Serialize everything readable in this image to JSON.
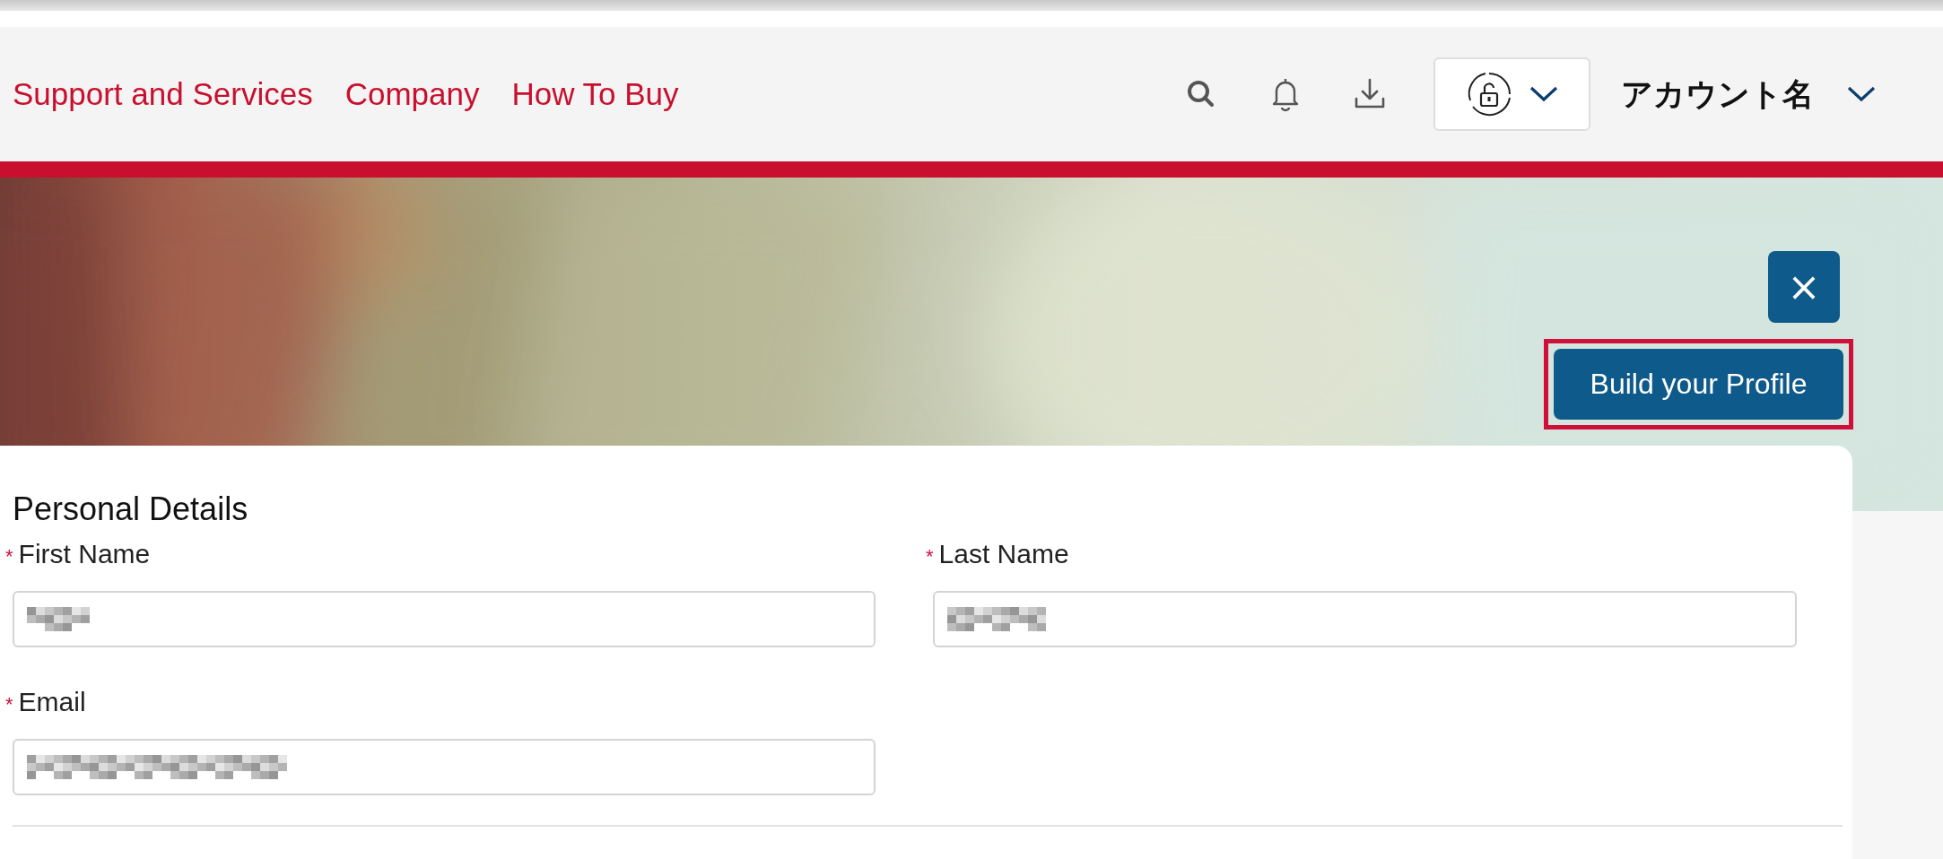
{
  "nav_links": [
    "Support and Services",
    "Company",
    "How To Buy"
  ],
  "account": {
    "name": "アカウント名"
  },
  "banner": {
    "kind": "picture",
    "close_button": "×",
    "profile_button": {
      "label": "Build your Profile",
      "highlighted": true
    }
  },
  "personal_details": {
    "title": "Personal Details",
    "fields": [
      {
        "label": "First Name",
        "required_mark": "*",
        "redacted": true
      },
      {
        "label": "Last Name",
        "required_mark": "*",
        "redacted": true
      },
      {
        "label": "Email",
        "required_mark": "*",
        "redacted": true
      }
    ]
  }
}
